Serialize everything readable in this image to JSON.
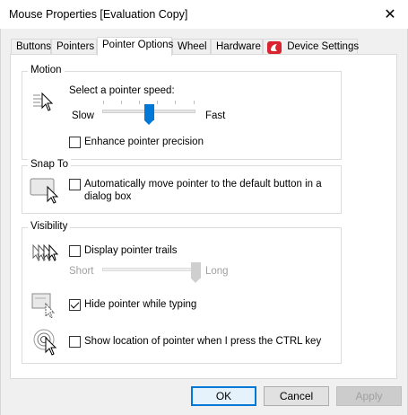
{
  "window": {
    "title": "Mouse Properties [Evaluation Copy]",
    "close_glyph": "✕"
  },
  "tabs": [
    {
      "label": "Buttons",
      "active": false
    },
    {
      "label": "Pointers",
      "active": false
    },
    {
      "label": "Pointer Options",
      "active": true
    },
    {
      "label": "Wheel",
      "active": false
    },
    {
      "label": "Hardware",
      "active": false
    },
    {
      "label": "Device Settings",
      "active": false,
      "icon": "synaptics-red-icon"
    }
  ],
  "motion": {
    "group_label": "Motion",
    "icon": "pointer-speed-icon",
    "speed_label": "Select a pointer speed:",
    "slow_label": "Slow",
    "fast_label": "Fast",
    "speed_value": 6,
    "speed_max": 11,
    "enhance_label": "Enhance pointer precision",
    "enhance_checked": false
  },
  "snap_to": {
    "group_label": "Snap To",
    "icon": "snap-to-button-icon",
    "auto_move_label_line1": "Automatically move pointer to the default button in a",
    "auto_move_label_line2": "dialog box",
    "auto_move_checked": false
  },
  "visibility": {
    "group_label": "Visibility",
    "trails_icon": "pointer-trails-icon",
    "trails_label": "Display pointer trails",
    "trails_checked": false,
    "short_label": "Short",
    "long_label": "Long",
    "trails_value": 1.0,
    "hide_icon": "hide-pointer-icon",
    "hide_label": "Hide pointer while typing",
    "hide_checked": true,
    "show_icon": "pointer-location-icon",
    "show_label": "Show location of pointer when I press the CTRL key",
    "show_checked": false
  },
  "buttons": {
    "ok": "OK",
    "cancel": "Cancel",
    "apply": "Apply"
  },
  "colors": {
    "accent": "#0078d7",
    "disabled_text": "#a0a0a0",
    "synaptics_red": "#d9232e"
  }
}
